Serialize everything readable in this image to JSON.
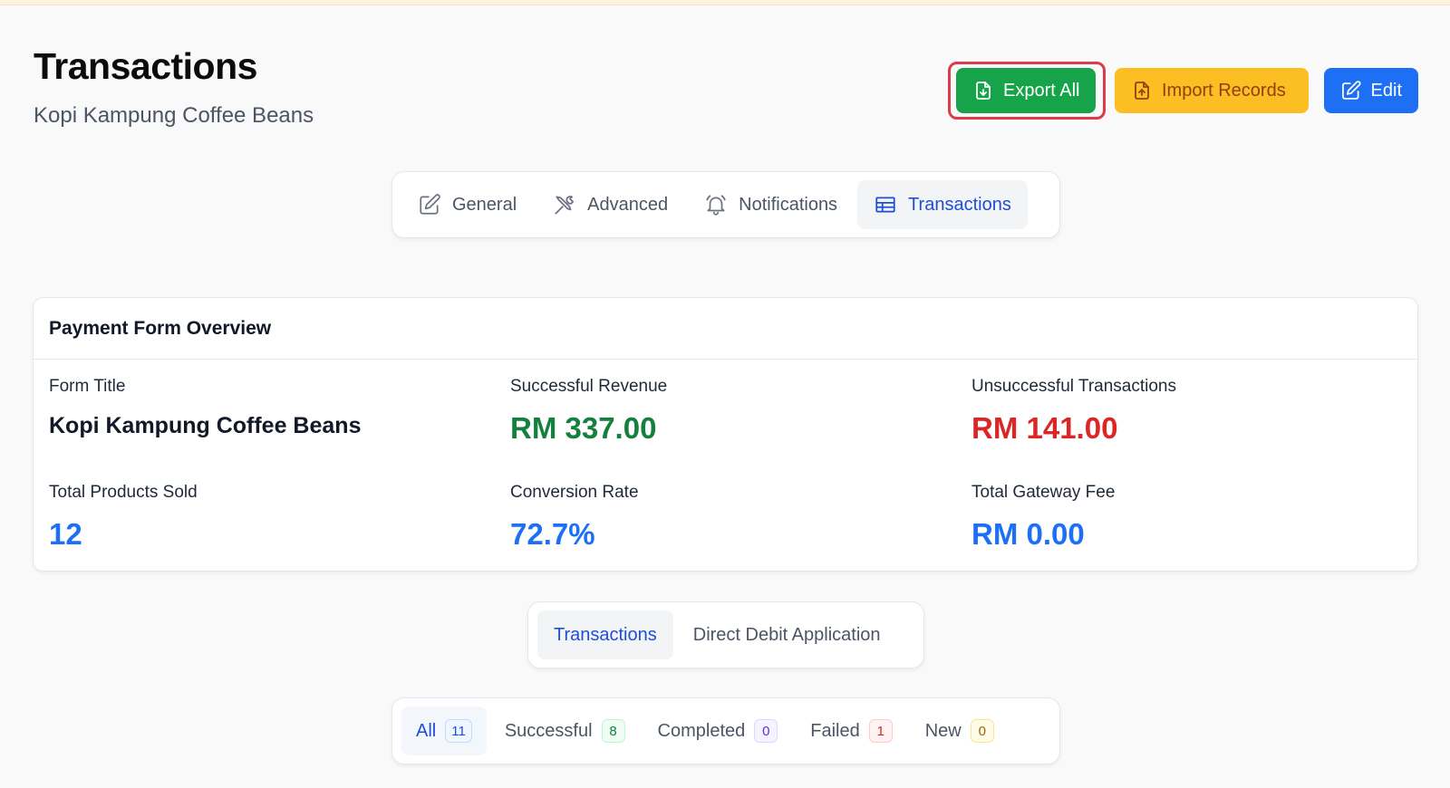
{
  "header": {
    "title": "Transactions",
    "subtitle": "Kopi Kampung Coffee Beans"
  },
  "actions": {
    "export_label": "Export All",
    "import_label": "Import Records",
    "edit_label": "Edit"
  },
  "main_tabs": [
    {
      "label": "General",
      "icon": "edit-icon"
    },
    {
      "label": "Advanced",
      "icon": "tools-icon"
    },
    {
      "label": "Notifications",
      "icon": "bell-icon"
    },
    {
      "label": "Transactions",
      "icon": "table-icon",
      "active": true
    }
  ],
  "overview": {
    "heading": "Payment Form Overview",
    "stats": [
      {
        "label": "Form Title",
        "value": "Kopi Kampung Coffee Beans"
      },
      {
        "label": "Successful Revenue",
        "value": "RM 337.00"
      },
      {
        "label": "Unsuccessful Transactions",
        "value": "RM 141.00"
      },
      {
        "label": "Total Products Sold",
        "value": "12"
      },
      {
        "label": "Conversion Rate",
        "value": "72.7%"
      },
      {
        "label": "Total Gateway Fee",
        "value": "RM 0.00"
      }
    ]
  },
  "sub_tabs": [
    {
      "label": "Transactions",
      "active": true
    },
    {
      "label": "Direct Debit Application"
    }
  ],
  "filters": [
    {
      "label": "All",
      "count": "11",
      "active": true
    },
    {
      "label": "Successful",
      "count": "8"
    },
    {
      "label": "Completed",
      "count": "0"
    },
    {
      "label": "Failed",
      "count": "1"
    },
    {
      "label": "New",
      "count": "0"
    }
  ],
  "colors": {
    "export": "#16a34a",
    "import": "#fbbf24",
    "edit": "#1d6ff5",
    "success": "#15803d",
    "danger": "#dc2626",
    "accent": "#1d4ed8"
  }
}
